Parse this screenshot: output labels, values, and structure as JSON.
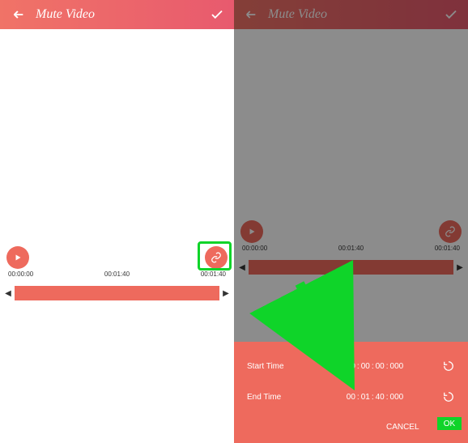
{
  "header": {
    "title": "Mute Video"
  },
  "left": {
    "time_start": "00:00:00",
    "time_mid": "00:01:40",
    "time_end": "00:01:40"
  },
  "right": {
    "time_start": "00:00:00",
    "time_mid": "00:01:40",
    "time_end": "00:01:40"
  },
  "panel": {
    "start_label": "Start Time",
    "end_label": "End Time",
    "start": {
      "h": "00",
      "m": "00",
      "s": "00",
      "ms": "000"
    },
    "end": {
      "h": "00",
      "m": "01",
      "s": "40",
      "ms": "000"
    },
    "cancel": "CANCEL",
    "ok": "OK"
  }
}
